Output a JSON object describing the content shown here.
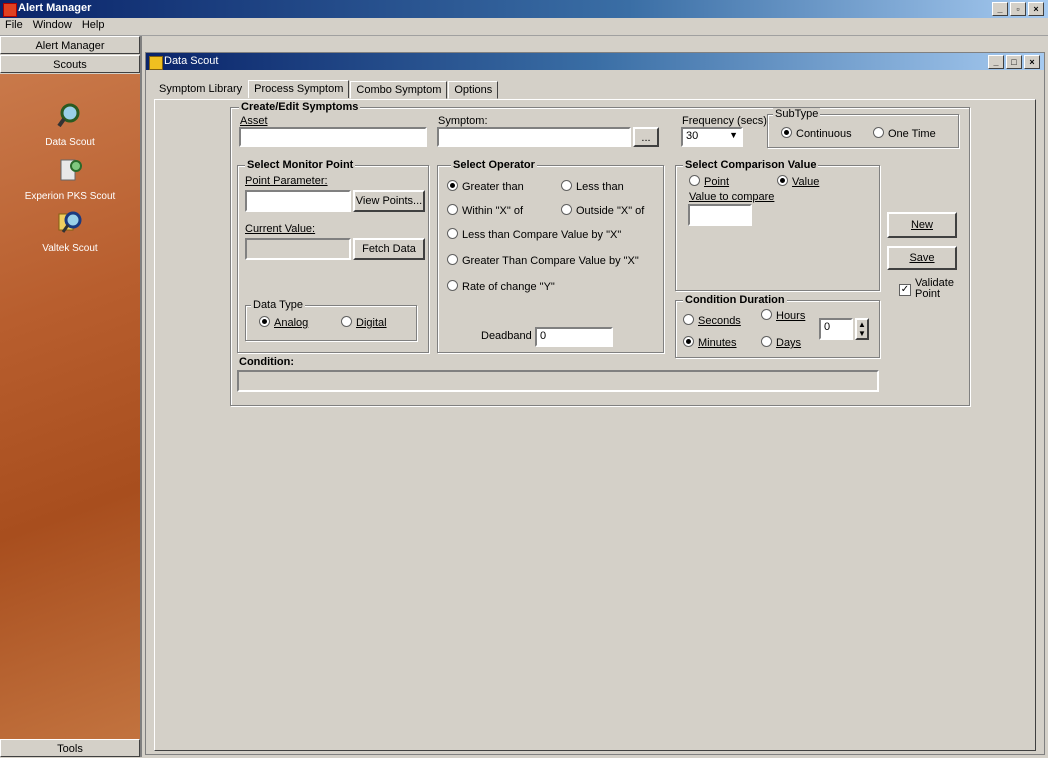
{
  "app": {
    "title": "Alert Manager"
  },
  "menu": [
    "File",
    "Window",
    "Help"
  ],
  "sidebar": {
    "header_alert": "Alert Manager",
    "header_scouts": "Scouts",
    "items": [
      {
        "label": "Data Scout"
      },
      {
        "label": "Experion PKS Scout"
      },
      {
        "label": "Valtek Scout"
      }
    ],
    "footer": "Tools"
  },
  "child": {
    "title": "Data Scout"
  },
  "tabs": [
    "Symptom Library",
    "Process Symptom",
    "Combo Symptom",
    "Options"
  ],
  "form": {
    "create_edit": "Create/Edit Symptoms",
    "asset_label": "Asset",
    "symptom_label": "Symptom:",
    "ellipsis": "...",
    "frequency_label": "Frequency (secs):",
    "frequency_value": "30",
    "subtype_label": "SubType",
    "subtype_continuous": "Continuous",
    "subtype_onetime": "One Time",
    "monitor_title": "Select Monitor Point",
    "point_parameter": "Point Parameter:",
    "view_points": "View Points...",
    "current_value": "Current Value:",
    "fetch_data": "Fetch Data",
    "datatype_title": "Data Type",
    "analog": "Analog",
    "digital": "Digital",
    "operator_title": "Select Operator",
    "op_greater": "Greater than",
    "op_less": "Less than",
    "op_within": "Within \"X\" of",
    "op_outside": "Outside \"X\" of",
    "op_less_cmp": "Less than Compare Value by \"X\"",
    "op_greater_cmp": "Greater Than Compare Value by \"X\"",
    "op_rate": "Rate of change \"Y\"",
    "deadband_label": "Deadband =",
    "deadband_value": "0",
    "comparison_title": "Select Comparison Value",
    "cmp_point": "Point",
    "cmp_value": "Value",
    "value_to_compare": "Value to compare",
    "duration_title": "Condition Duration",
    "dur_seconds": "Seconds",
    "dur_hours": "Hours",
    "dur_minutes": "Minutes",
    "dur_days": "Days",
    "duration_value": "0",
    "new_button": "New",
    "save_button": "Save",
    "validate_point": "Validate Point",
    "condition_label": "Condition:"
  }
}
